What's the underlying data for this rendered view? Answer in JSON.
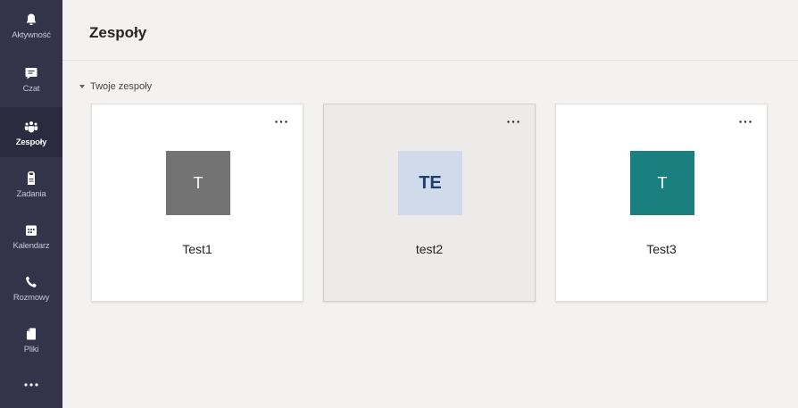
{
  "rail": {
    "items": [
      {
        "label": "Aktywność",
        "icon": "bell-icon"
      },
      {
        "label": "Czat",
        "icon": "chat-icon"
      },
      {
        "label": "Zespoły",
        "icon": "teams-icon",
        "active": true
      },
      {
        "label": "Zadania",
        "icon": "assignments-icon"
      },
      {
        "label": "Kalendarz",
        "icon": "calendar-icon"
      },
      {
        "label": "Rozmowy",
        "icon": "phone-icon"
      },
      {
        "label": "Pliki",
        "icon": "file-icon"
      }
    ],
    "more_icon": "more-apps-icon"
  },
  "header": {
    "title": "Zespoły"
  },
  "section": {
    "title": "Twoje zespoły",
    "expanded": true
  },
  "teams": [
    {
      "name": "Test1",
      "initials": "T",
      "color": "#737373",
      "initials_color": "#ffffff",
      "hovered": false
    },
    {
      "name": "test2",
      "initials": "TE",
      "color": "#cfdbea",
      "initials_color": "#1f3c6e",
      "hovered": true
    },
    {
      "name": "Test3",
      "initials": "T",
      "color": "#1a7f7f",
      "initials_color": "#ffffff",
      "hovered": false
    }
  ],
  "colors": {
    "rail_bg": "#33344a",
    "content_bg": "#f3f2f1"
  }
}
